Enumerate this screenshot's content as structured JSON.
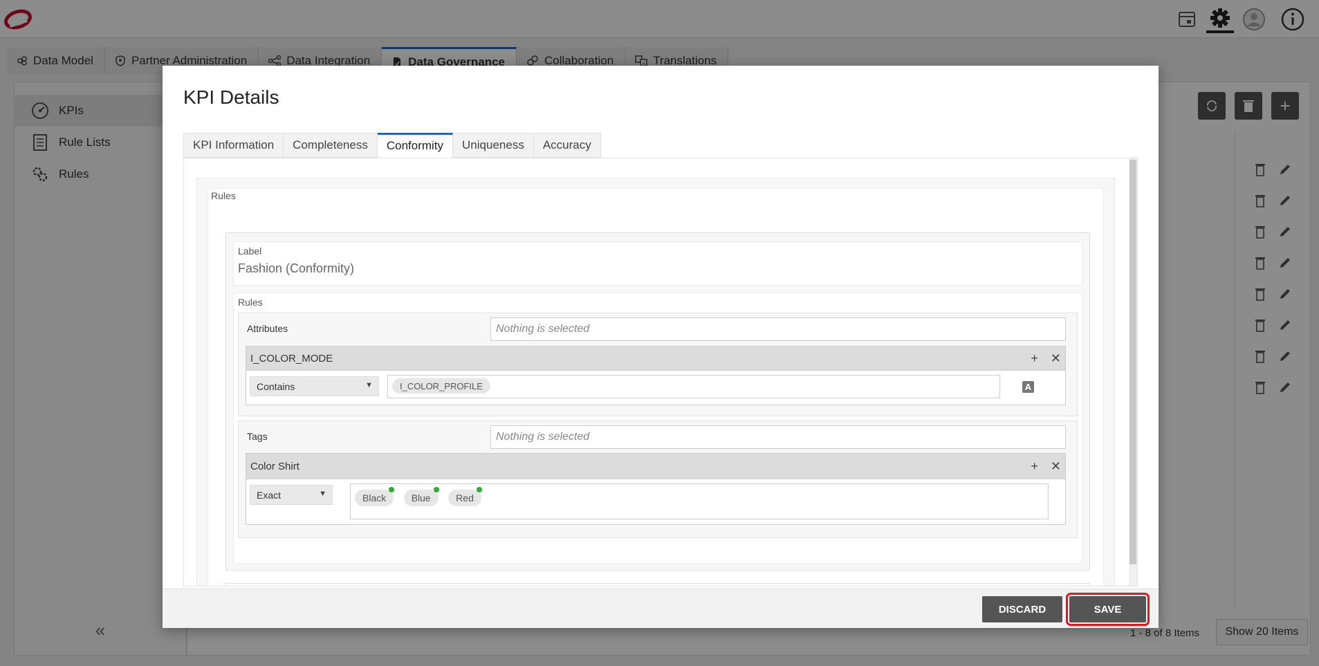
{
  "topbar": {
    "icons": [
      "logo-icon",
      "inbox-icon",
      "settings-gear-icon",
      "user-avatar-icon",
      "info-icon"
    ]
  },
  "module_tabs": [
    {
      "label": "Data Model",
      "icon": "data-model-icon",
      "active": false
    },
    {
      "label": "Partner Administration",
      "icon": "shield-icon",
      "active": false
    },
    {
      "label": "Data Integration",
      "icon": "integration-icon",
      "active": false
    },
    {
      "label": "Data Governance",
      "icon": "governance-icon",
      "active": true
    },
    {
      "label": "Collaboration",
      "icon": "collaboration-icon",
      "active": false
    },
    {
      "label": "Translations",
      "icon": "translations-icon",
      "active": false
    }
  ],
  "sidebar": {
    "items": [
      {
        "label": "KPIs",
        "icon": "gauge-icon",
        "active": true
      },
      {
        "label": "Rule Lists",
        "icon": "list-icon",
        "active": false
      },
      {
        "label": "Rules",
        "icon": "gears-icon",
        "active": false
      }
    ],
    "collapse_icon": "«"
  },
  "background_grid": {
    "row_count": 8,
    "pager_text": "1 - 8 of 8 Items",
    "show_button": "Show 20 Items"
  },
  "modal": {
    "title": "KPI Details",
    "tabs": [
      {
        "label": "KPI Information",
        "active": false
      },
      {
        "label": "Completeness",
        "active": false
      },
      {
        "label": "Conformity",
        "active": true
      },
      {
        "label": "Uniqueness",
        "active": false
      },
      {
        "label": "Accuracy",
        "active": false
      }
    ],
    "rules_section_label": "Rules",
    "label_field": {
      "caption": "Label",
      "value": "Fashion (Conformity)"
    },
    "inner_rules_label": "Rules",
    "attributes": {
      "caption": "Attributes",
      "placeholder": "Nothing is selected",
      "group": {
        "name": "I_COLOR_MODE",
        "operator": "Contains",
        "values": [
          "I_COLOR_PROFILE"
        ],
        "attr_toggle_glyph": "A"
      }
    },
    "tags": {
      "caption": "Tags",
      "placeholder": "Nothing is selected",
      "group": {
        "name": "Color Shirt",
        "operator": "Exact",
        "values": [
          "Black",
          "Blue",
          "Red"
        ]
      }
    },
    "footer": {
      "discard_label": "DISCARD",
      "save_label": "SAVE",
      "save_highlight_color": "#e0161f"
    }
  }
}
